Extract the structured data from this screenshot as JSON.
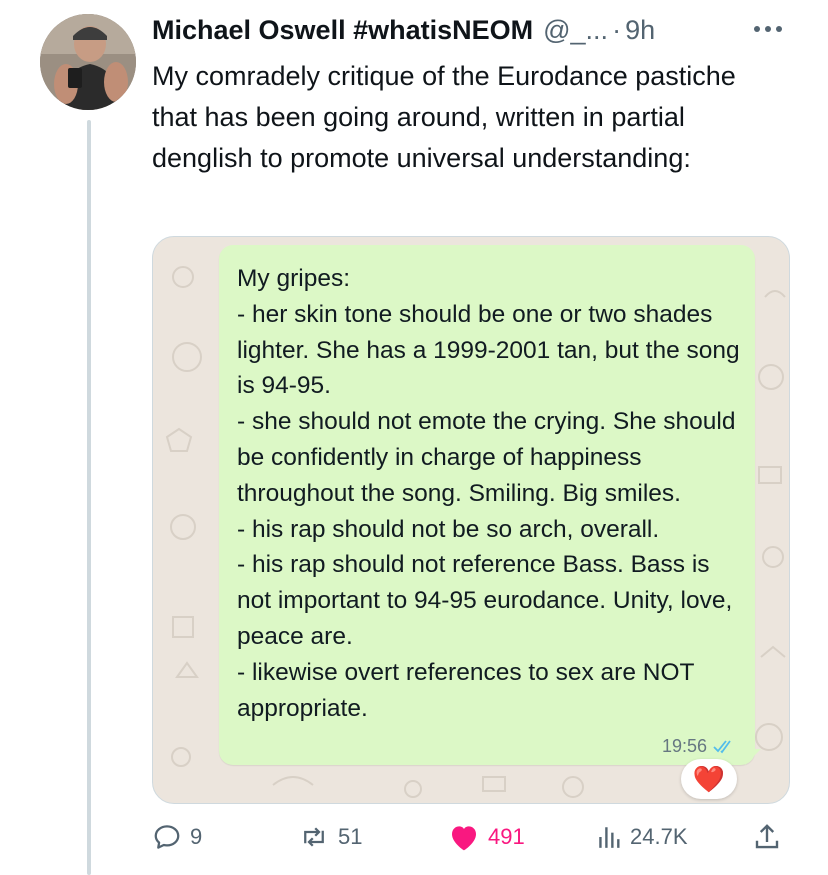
{
  "tweet": {
    "author_name": "Michael Oswell #whatisNEOM",
    "handle": "@_...",
    "separator": "·",
    "time": "9h",
    "text": "My comradely critique of the Eurodance pastiche that has been going around, written in partial denglish to promote universal understanding:",
    "more_icon": "more-horizontal-icon"
  },
  "media": {
    "message_text": "My gripes:\n- her skin tone should be one or two shades lighter. She has a 1999-2001 tan, but the song is 94-95.\n- she should not emote the crying. She should be confidently in charge of happiness throughout the song. Smiling. Big smiles.\n- his rap should not be so arch, overall.\n- his rap should not reference Bass. Bass is not important to 94-95 eurodance. Unity, love, peace are.\n- likewise overt references to sex are NOT appropriate.",
    "message_time": "19:56",
    "read_receipt_icon": "double-check-icon",
    "reaction": "❤️",
    "bubble_color": "#dcf8c6",
    "background_color": "#ece5dd"
  },
  "actions": {
    "reply_count": "9",
    "retweet_count": "51",
    "like_count": "491",
    "views_count": "24.7K",
    "like_color": "#f91880",
    "icon_color": "#536471"
  }
}
